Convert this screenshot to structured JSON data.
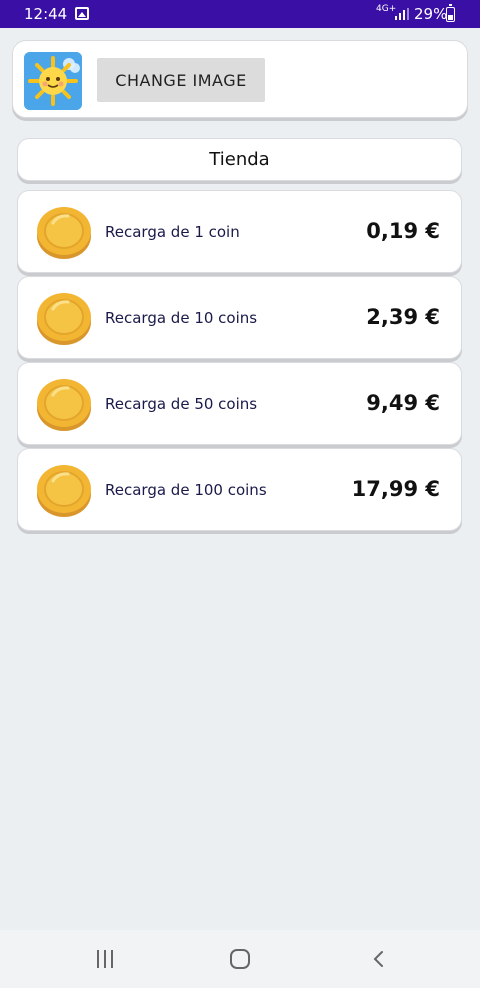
{
  "status_bar": {
    "time": "12:44",
    "network": "4G+",
    "battery": "29%",
    "icons": [
      "image-notification-icon",
      "signal-icon",
      "battery-icon"
    ]
  },
  "profile": {
    "avatar_icon": "sun-avatar-icon",
    "change_image_label": "CHANGE IMAGE"
  },
  "shop": {
    "title": "Tienda",
    "items": [
      {
        "label": "Recarga de 1 coin",
        "price": "0,19 €",
        "icon": "coin-icon"
      },
      {
        "label": "Recarga de 10 coins",
        "price": "2,39 €",
        "icon": "coin-icon"
      },
      {
        "label": "Recarga de 50 coins",
        "price": "9,49 €",
        "icon": "coin-icon"
      },
      {
        "label": "Recarga de 100 coins",
        "price": "17,99 €",
        "icon": "coin-icon"
      }
    ]
  },
  "nav_bar": {
    "icons": [
      "recent-apps-icon",
      "home-icon",
      "back-icon"
    ]
  },
  "colors": {
    "status_bar": "#3a0fa6",
    "background": "#eceff2",
    "coin": "#f2b632",
    "avatar_bg": "#4aa6e8"
  }
}
